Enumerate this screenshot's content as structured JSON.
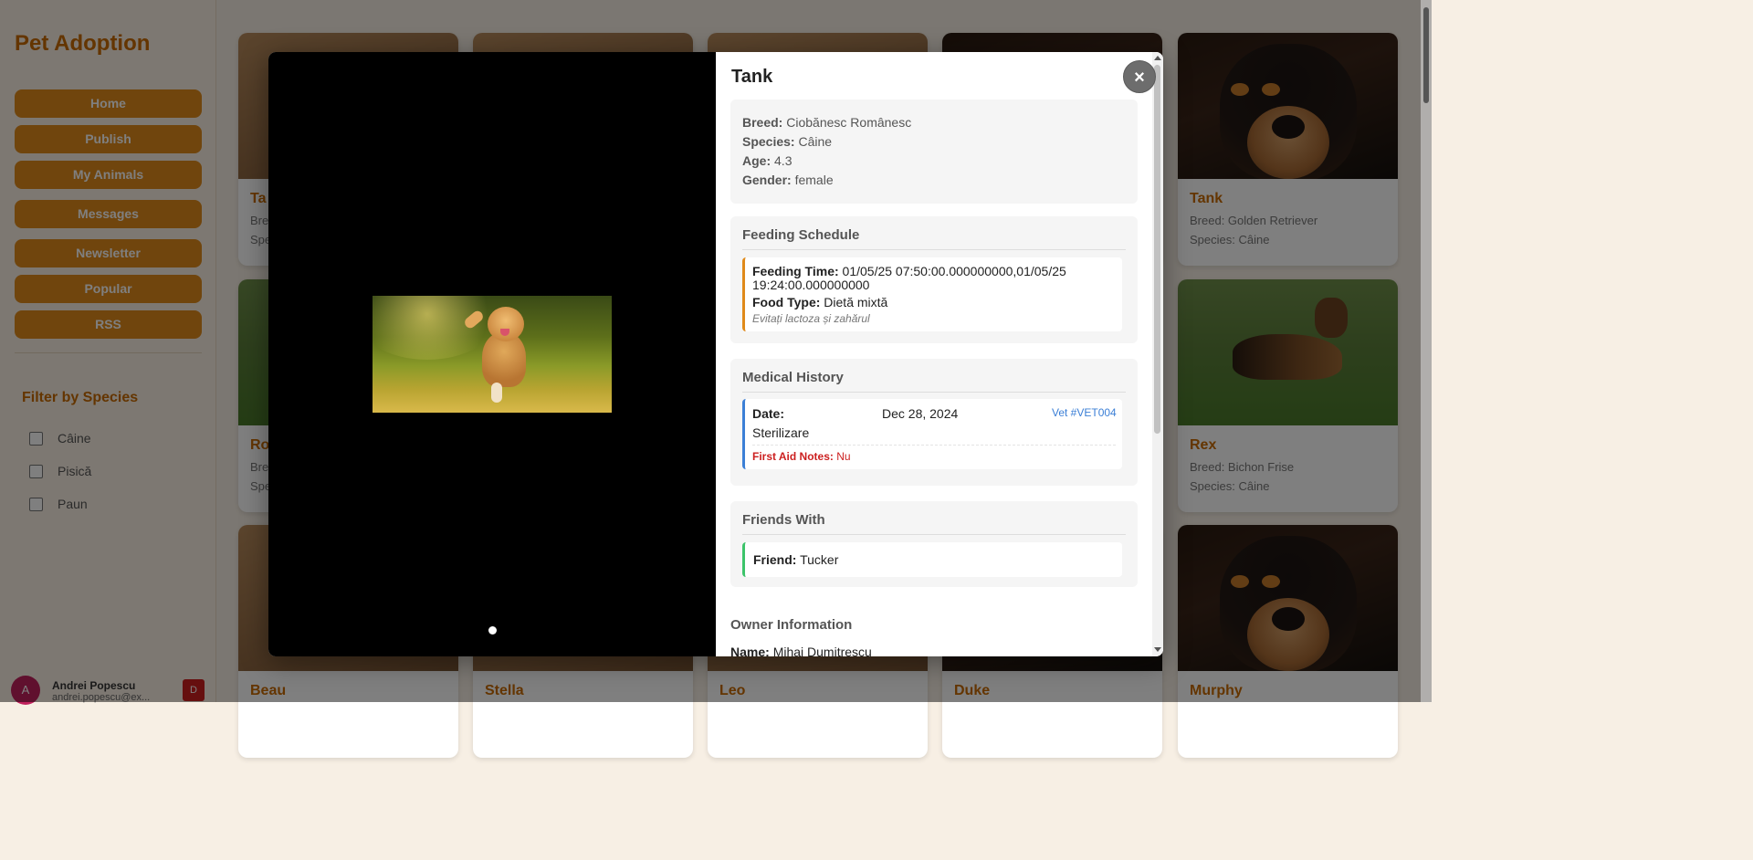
{
  "sidebar": {
    "brand": "Pet Adoption",
    "nav": [
      "Home",
      "Publish",
      "My Animals",
      "Messages",
      "Newsletter",
      "Popular",
      "RSS"
    ],
    "filter_title": "Filter by Species",
    "filters": [
      "Câine",
      "Pisică",
      "Paun"
    ],
    "user": {
      "initial": "A",
      "name": "Andrei Popescu",
      "email": "andrei.popescu@ex...",
      "logout": "D"
    }
  },
  "cards": [
    {
      "name": "Tank",
      "breed": "Breed: Golden Retriever",
      "species": "Species: Câine"
    },
    {
      "name": "Rex",
      "breed": "Breed: Bichon Frise",
      "species": "Species: Câine"
    },
    {
      "name": "Murphy"
    },
    {
      "name": "Beau"
    },
    {
      "name": "Stella"
    },
    {
      "name": "Leo"
    },
    {
      "name": "Duke"
    },
    {
      "name": "Ta"
    },
    {
      "name": "Ro"
    },
    {
      "partial_breed": "Bre",
      "partial_species": "Spe"
    }
  ],
  "modal": {
    "title": "Tank",
    "close": "×",
    "info": {
      "breed_label": "Breed:",
      "breed": "Ciobănesc Românesc",
      "species_label": "Species:",
      "species": "Câine",
      "age_label": "Age:",
      "age": "4.3",
      "gender_label": "Gender:",
      "gender": "female"
    },
    "feeding": {
      "title": "Feeding Schedule",
      "time_label": "Feeding Time:",
      "time_line1": "01/05/25 07:50:00.000000000,01/05/25",
      "time_line2": "19:24:00.000000000",
      "food_label": "Food Type:",
      "food": "Dietă mixtă",
      "note": "Evitați lactoza și zahărul"
    },
    "medical": {
      "title": "Medical History",
      "date_label": "Date:",
      "date": "Dec 28, 2024",
      "vet": "Vet #VET004",
      "procedure": "Sterilizare",
      "first_aid_label": "First Aid Notes:",
      "first_aid": "Nu"
    },
    "friends": {
      "title": "Friends With",
      "friend_label": "Friend:",
      "friend": "Tucker"
    },
    "owner": {
      "title": "Owner Information",
      "name_label": "Name:",
      "name": "Mihai Dumitrescu"
    }
  },
  "colors": {
    "accent": "#e08a1a",
    "brand": "#c96a00",
    "medical": "#3b7fd6",
    "friends": "#3cc46a",
    "danger": "#cc1f1f"
  }
}
